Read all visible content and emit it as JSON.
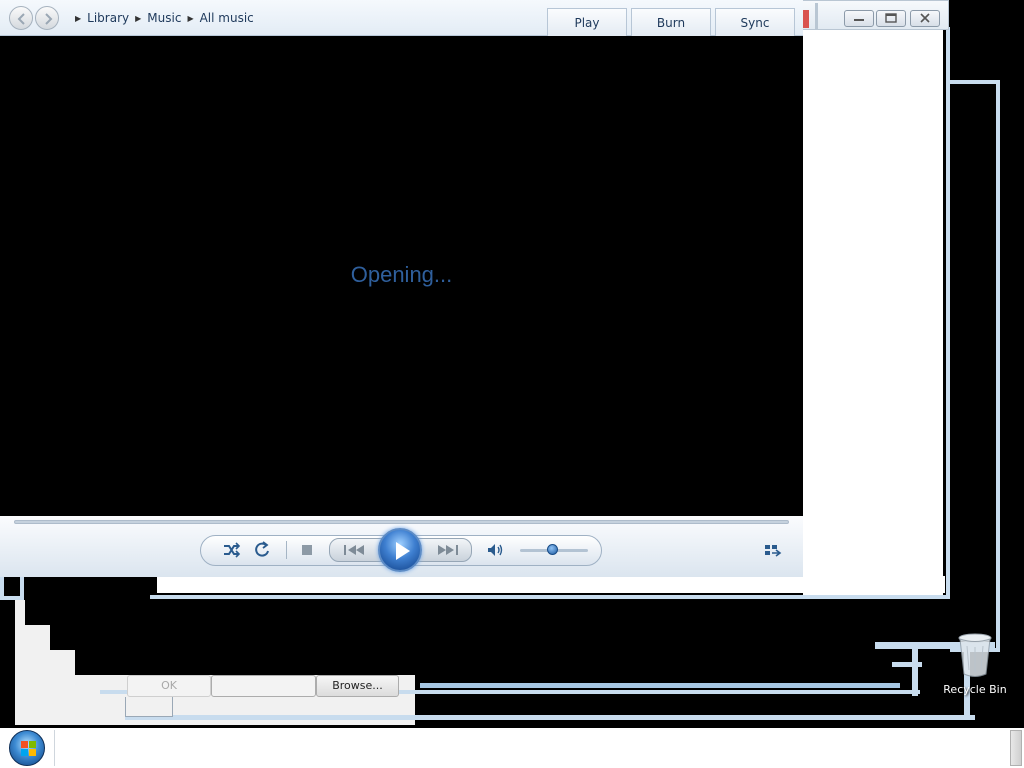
{
  "player": {
    "nav": {
      "back_label": "",
      "forward_label": "",
      "breadcrumb": [
        "Library",
        "Music",
        "All music"
      ]
    },
    "tabs": [
      {
        "label": "Play"
      },
      {
        "label": "Burn"
      },
      {
        "label": "Sync"
      }
    ],
    "status_text": "Opening...",
    "controls": {
      "shuffle_icon": "shuffle-icon",
      "repeat_icon": "repeat-icon",
      "stop_icon": "stop-icon",
      "previous_icon": "previous-icon",
      "play_icon": "play-icon",
      "next_icon": "next-icon",
      "mute_icon": "speaker-icon",
      "switch_view_icon": "switch-to-library-icon",
      "volume_level": 0.5,
      "seek_position": 0
    },
    "colors": {
      "status_text": "#2f5f9c",
      "accent": "#3e7fd0"
    }
  },
  "window_controls": {
    "minimize": "minimize-icon",
    "maximize": "maximize-icon",
    "close": "close-icon"
  },
  "dialog_fragments": {
    "ok_label": "OK",
    "browse_label": "Browse..."
  },
  "desktop": {
    "recycle_bin_label": "Recycle Bin"
  },
  "taskbar": {
    "start_icon": "start-orb-icon"
  }
}
